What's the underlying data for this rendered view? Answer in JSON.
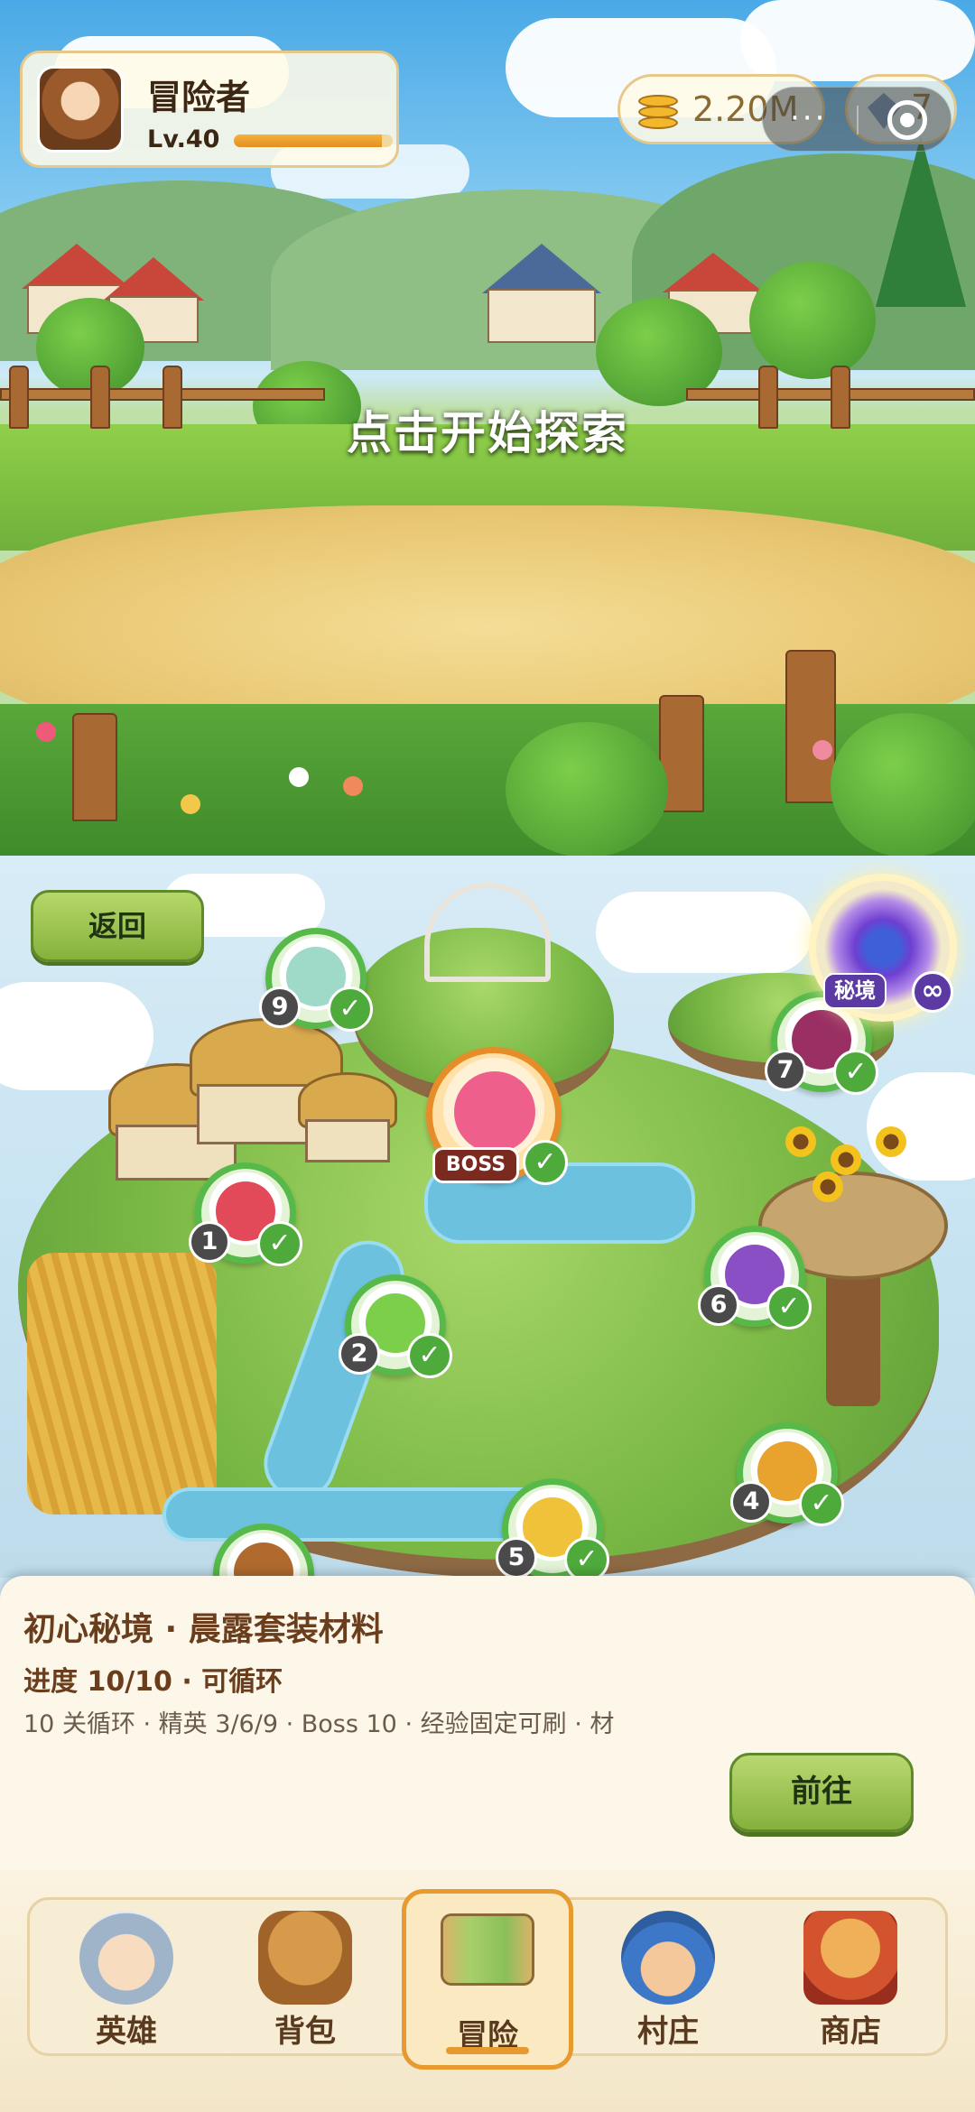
{
  "player": {
    "name": "冒险者",
    "level": "Lv.40",
    "xp_fraction": 0.93
  },
  "currency": {
    "coins": "2.20M",
    "gems": "7"
  },
  "scene": {
    "prompt": "点击开始探索"
  },
  "map": {
    "back_label": "返回",
    "portal": {
      "label": "秘境",
      "badge": "∞"
    },
    "boss": {
      "tag": "BOSS",
      "cleared": true
    },
    "stages": [
      {
        "num": "1",
        "cleared": true,
        "color": "#e24a5a"
      },
      {
        "num": "2",
        "cleared": true,
        "color": "#7ccf4a"
      },
      {
        "num": "4",
        "cleared": true,
        "color": "#e8a22e"
      },
      {
        "num": "5",
        "cleared": true,
        "color": "#f0c23a"
      },
      {
        "num": "6",
        "cleared": true,
        "color": "#8a4fc4"
      },
      {
        "num": "7",
        "cleared": true,
        "color": "#9a2f64"
      },
      {
        "num": "9",
        "cleared": true,
        "color": "#9fd9c8"
      }
    ],
    "check_glyph": "✓"
  },
  "panel": {
    "title": "初心秘境 · 晨露套装材料",
    "progress": "进度 10/10 · 可循环",
    "desc": "10 关循环 · 精英 3/6/9 · Boss 10 · 经验固定可刷 · 材",
    "go_label": "前往"
  },
  "nav": {
    "items": [
      {
        "label": "英雄",
        "active": false,
        "icon": "hero-icon"
      },
      {
        "label": "背包",
        "active": false,
        "icon": "backpack-icon"
      },
      {
        "label": "冒险",
        "active": true,
        "icon": "map-scroll-icon"
      },
      {
        "label": "村庄",
        "active": false,
        "icon": "villager-icon"
      },
      {
        "label": "商店",
        "active": false,
        "icon": "shop-icon"
      }
    ]
  },
  "capsule": {
    "more_glyph": "···"
  }
}
